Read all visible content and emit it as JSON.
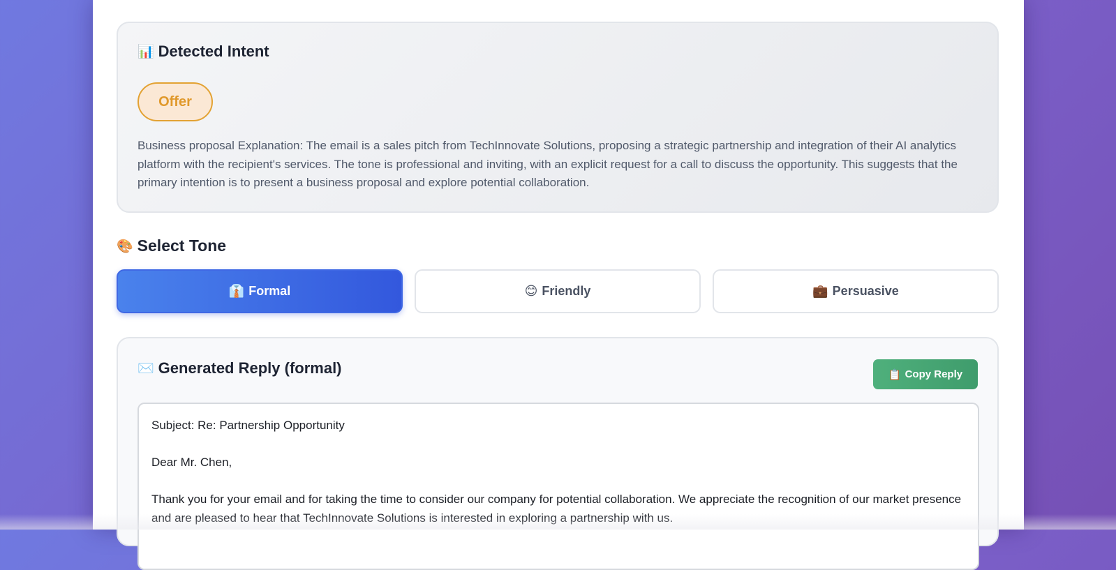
{
  "intent": {
    "icon": "📊",
    "icon_name": "bar-chart-icon",
    "title": "Detected Intent",
    "badge": "Offer",
    "explanation": "Business proposal Explanation: The email is a sales pitch from TechInnovate Solutions, proposing a strategic partnership and integration of their AI analytics platform with the recipient's services. The tone is professional and inviting, with an explicit request for a call to discuss the opportunity. This suggests that the primary intention is to present a business proposal and explore potential collaboration."
  },
  "tone": {
    "icon": "🎨",
    "icon_name": "palette-icon",
    "title": "Select Tone",
    "options": [
      {
        "icon": "👔",
        "icon_name": "necktie-icon",
        "label": "Formal",
        "selected": true
      },
      {
        "icon": "😊",
        "icon_name": "smiley-icon",
        "label": "Friendly",
        "selected": false
      },
      {
        "icon": "💼",
        "icon_name": "briefcase-icon",
        "label": "Persuasive",
        "selected": false
      }
    ]
  },
  "reply": {
    "icon": "✉️",
    "icon_name": "envelope-icon",
    "title": "Generated Reply (formal)",
    "copy_icon": "📋",
    "copy_label": "Copy Reply",
    "lines": [
      "Subject: Re: Partnership Opportunity",
      "Dear Mr. Chen,",
      "Thank you for your email and for taking the time to consider our company for potential collaboration. We appreciate the recognition of our market presence and are pleased to hear that TechInnovate Solutions is interested in exploring a partnership with us."
    ]
  },
  "colors": {
    "background_start": "#7079e0",
    "background_end": "#7650b5",
    "badge_accent": "#e3a233",
    "tone_active": "#3f68e4",
    "copy_button": "#46a574"
  }
}
